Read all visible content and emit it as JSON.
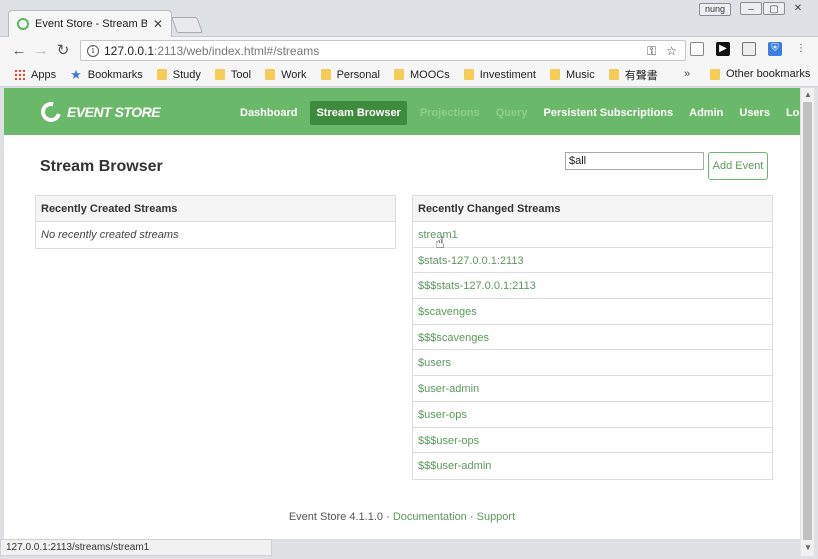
{
  "browser": {
    "tab_title": "Event Store - Stream Bro",
    "user_badge": "nung",
    "url_host": "127.0.0.1",
    "url_rest": ":2113/web/index.html#/streams",
    "status_url": "127.0.0.1:2113/streams/stream1"
  },
  "bookmarks": {
    "apps": "Apps",
    "items": [
      "Bookmarks",
      "Study",
      "Tool",
      "Work",
      "Personal",
      "MOOCs",
      "Investiment",
      "Music",
      "有聲書"
    ],
    "more": "»",
    "other": "Other bookmarks"
  },
  "app": {
    "logo_text": "EVENT STORE",
    "nav": [
      "Dashboard",
      "Stream Browser",
      "Projections",
      "Query",
      "Persistent Subscriptions",
      "Admin",
      "Users",
      "Log Out"
    ],
    "page_title": "Stream Browser",
    "stream_input_value": "$all",
    "add_event_label": "Add Event"
  },
  "recently_created": {
    "title": "Recently Created Streams",
    "empty_text": "No recently created streams"
  },
  "recently_changed": {
    "title": "Recently Changed Streams",
    "streams": [
      "stream1",
      "$stats-127.0.0.1:2113",
      "$$$stats-127.0.0.1:2113",
      "$scavenges",
      "$$$scavenges",
      "$users",
      "$user-admin",
      "$user-ops",
      "$$$user-ops",
      "$$$user-admin"
    ]
  },
  "footer": {
    "version": "Event Store 4.1.1.0",
    "sep": "·",
    "documentation": "Documentation",
    "support": "Support"
  },
  "colors": {
    "header_green": "#6ab86a",
    "active_nav": "#3d8b3d",
    "link_green": "#5a9a5a"
  }
}
